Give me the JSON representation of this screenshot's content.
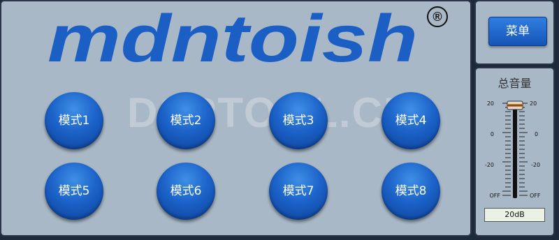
{
  "brand": {
    "name": "mdntoish",
    "registered_mark": "®"
  },
  "watermark": "DSPTOOL.CN",
  "modes": [
    "模式1",
    "模式2",
    "模式3",
    "模式4",
    "模式5",
    "模式6",
    "模式7",
    "模式8"
  ],
  "menu": {
    "label": "菜单"
  },
  "volume": {
    "title": "总音量",
    "scale_labels": [
      "20",
      "0",
      "-20",
      "OFF"
    ],
    "value_display": "20dB",
    "level_db": 20
  },
  "colors": {
    "panel": "#a9b8c6",
    "background": "#1d2a3c",
    "button_blue": "#1c63c9",
    "logo_blue": "#1b5fc4"
  }
}
